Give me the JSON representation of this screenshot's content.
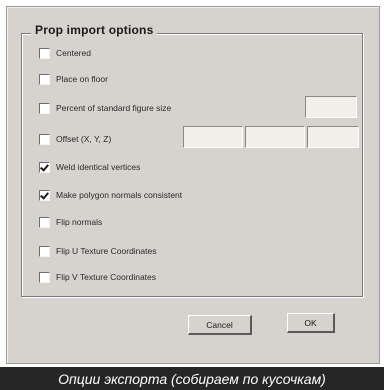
{
  "dialog": {
    "group_title": "Prop import options",
    "options": [
      {
        "label": "Centered",
        "checked": false
      },
      {
        "label": "Place on floor",
        "checked": false
      },
      {
        "label": "Percent of standard figure size",
        "checked": false
      },
      {
        "label": "Offset (X, Y, Z)",
        "checked": false
      },
      {
        "label": "Weld identical vertices",
        "checked": true
      },
      {
        "label": "Make polygon normals consistent",
        "checked": true
      },
      {
        "label": "Flip normals",
        "checked": false
      },
      {
        "label": "Flip U Texture Coordinates",
        "checked": false
      },
      {
        "label": "Flip V Texture Coordinates",
        "checked": false
      }
    ],
    "fields": {
      "percent_value": "",
      "offset_x": "",
      "offset_y": "",
      "offset_z": ""
    },
    "buttons": {
      "cancel_label": "Cancel",
      "ok_label": "OK"
    }
  },
  "caption": "Опции экспорта (собираем по кусочкам)"
}
